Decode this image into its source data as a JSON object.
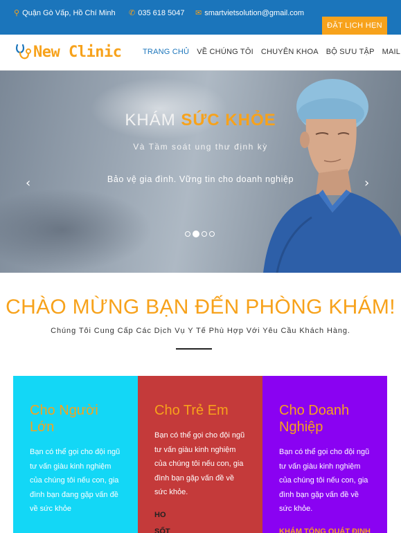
{
  "topbar": {
    "address": "Quận Gò Vấp, Hồ Chí Minh",
    "phone": "035 618 5047",
    "email": "smartvietsolution@gmail.com",
    "book_label": "ĐẶT LỊCH HẸN",
    "icons": {
      "address": "map-pin-icon",
      "phone": "phone-icon",
      "email": "envelope-icon"
    }
  },
  "logo": {
    "text": "New Clinic",
    "icon": "stethoscope-icon"
  },
  "nav": {
    "items": [
      {
        "label": "TRANG CHỦ",
        "active": true
      },
      {
        "label": "VỀ CHÚNG TÔI",
        "active": false
      },
      {
        "label": "CHUYÊN KHOA",
        "active": false
      },
      {
        "label": "BỘ SƯU TẬP",
        "active": false
      },
      {
        "label": "MAIL",
        "active": false
      }
    ]
  },
  "hero": {
    "title_plain": "KHÁM ",
    "title_highlight": "SỨC KHỎE",
    "subtitle": "Và Tầm soát ung thư định kỳ",
    "tagline": "Bảo vệ gia đình. Vững tin cho doanh nghiệp",
    "prev_arrow": "‹",
    "next_arrow": "›",
    "slide_count": 4,
    "active_slide": 1
  },
  "welcome": {
    "title": "CHÀO MỪNG BẠN ĐẾN PHÒNG KHÁM!",
    "subtitle": "Chúng Tôi Cung Cấp Các Dịch Vụ Y Tế Phù Hợp Với Yêu Cầu Khách Hàng."
  },
  "cards": [
    {
      "title": "Cho Người Lớn",
      "desc": "Bạn có thể gọi cho đội ngũ tư vấn giàu kinh nghiệm của chúng tôi nếu con, gia đình bạn đang gặp vấn đề về sức khỏe",
      "extra": ""
    },
    {
      "title": "Cho Trẻ Em",
      "desc": "Bạn có thể gọi cho đội ngũ tư vấn giàu kinh nghiệm của chúng tôi nếu con, gia đình bạn gặp vấn đề về sức khỏe.",
      "extra_lines": [
        "HO",
        "SỐT"
      ]
    },
    {
      "title": "Cho Doanh Nghiệp",
      "desc": "Bạn có thể gọi cho đội ngũ tư vấn giàu kinh nghiệm của chúng tôi nếu con, gia đình bạn gặp vấn đề về sức khỏe.",
      "extra_lines": [
        "KHÁM TỔNG QUÁT ĐỊNH"
      ]
    }
  ],
  "colors": {
    "topbar": "#1b75bb",
    "accent": "#f7a21b",
    "card_adult": "#13d7f6",
    "card_child": "#c43a3a",
    "card_business": "#8a02f2"
  }
}
